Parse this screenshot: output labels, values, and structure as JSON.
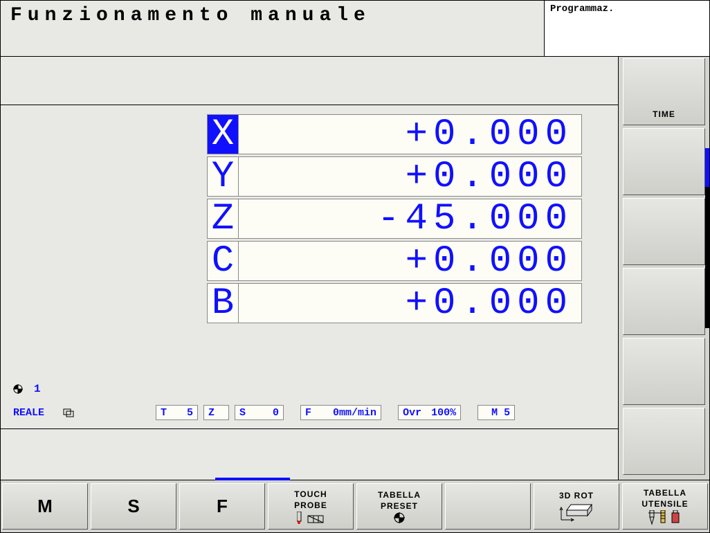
{
  "header": {
    "title": "Funzionamento manuale",
    "sub": "Programmaz."
  },
  "axes": [
    {
      "label": "X",
      "value": "+0.000",
      "selected": true
    },
    {
      "label": "Y",
      "value": "+0.000",
      "selected": false
    },
    {
      "label": "Z",
      "value": "-45.000",
      "selected": false
    },
    {
      "label": "C",
      "value": "+0.000",
      "selected": false
    },
    {
      "label": "B",
      "value": "+0.000",
      "selected": false
    }
  ],
  "preset_number": "1",
  "status": {
    "mode": "REALE",
    "T": "5",
    "Z": "",
    "S": "0",
    "F": "0mm/min",
    "Ovr": "100%",
    "M": "M 5"
  },
  "right_buttons": [
    "TIME",
    "",
    "",
    "",
    "",
    ""
  ],
  "softkeys": {
    "m": "M",
    "s": "S",
    "f": "F",
    "touch1": "TOUCH",
    "touch2": "PROBE",
    "tab1": "TABELLA",
    "tab2": "PRESET",
    "rot": "3D ROT",
    "ut1": "TABELLA",
    "ut2": "UTENSILE"
  }
}
